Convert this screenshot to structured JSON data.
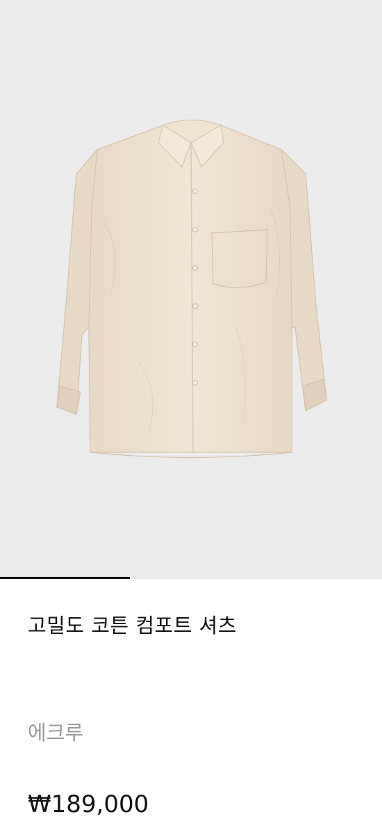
{
  "gallery": {
    "image_alt": "shirt-product-image",
    "current_slide_fraction": 0.34,
    "image_bg_color": "#ebebeb",
    "shirt_color": "#eee0cf"
  },
  "product": {
    "name": "고밀도 코튼 컴포트 셔츠",
    "color_name": "에크루",
    "price": "₩189,000"
  }
}
